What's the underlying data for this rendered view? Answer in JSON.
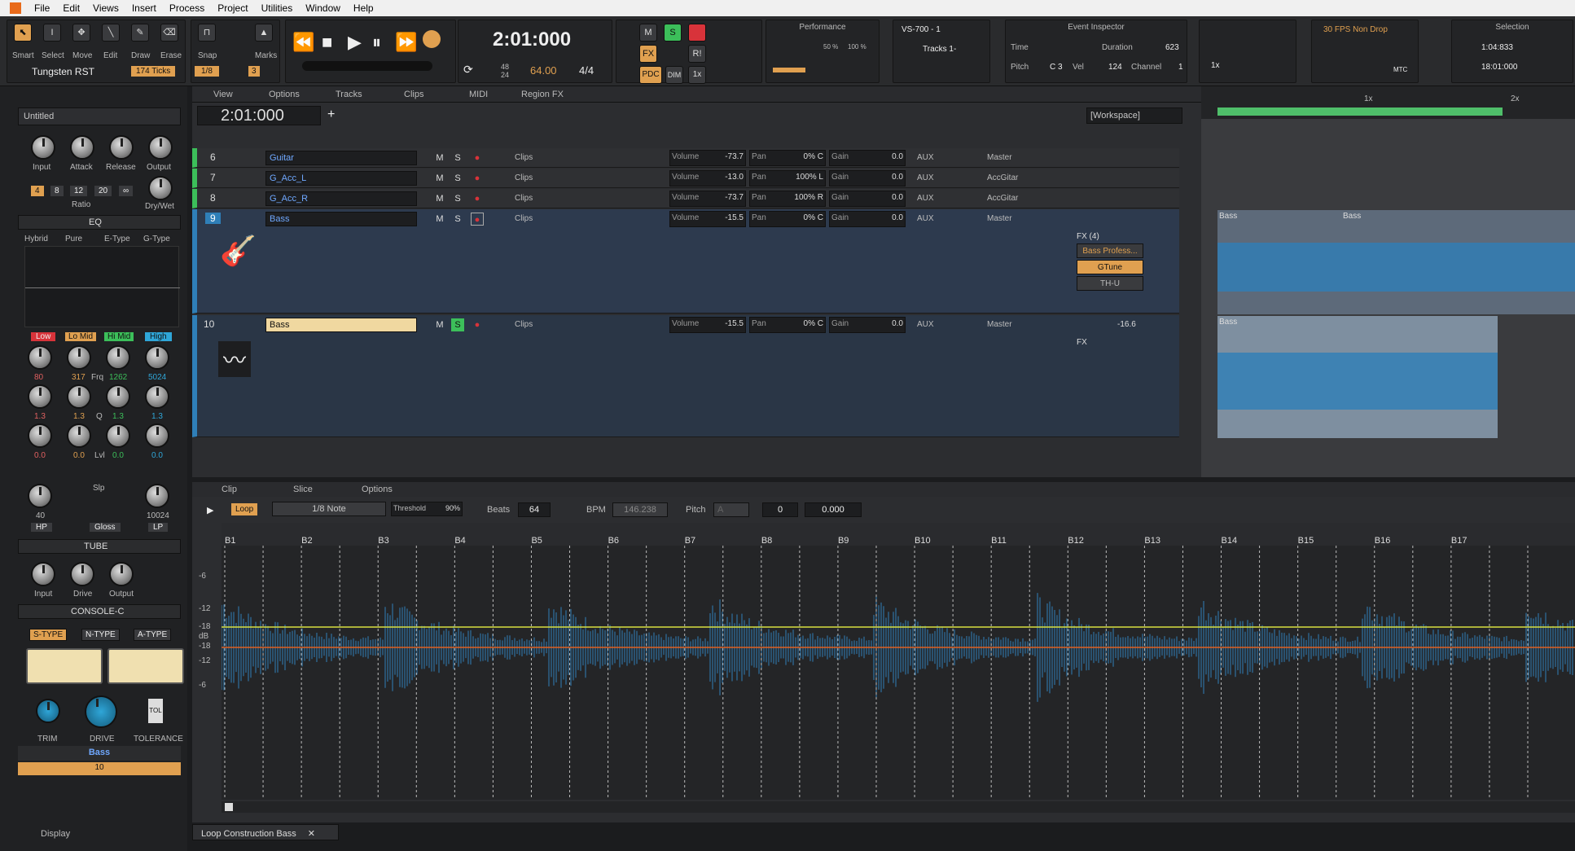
{
  "menu": [
    "File",
    "Edit",
    "Views",
    "Insert",
    "Process",
    "Project",
    "Utilities",
    "Window",
    "Help"
  ],
  "tools": {
    "labels": [
      "Smart",
      "Select",
      "Move",
      "Edit",
      "Draw",
      "Erase"
    ],
    "preset": "Tungsten RST",
    "ticks": "174 Ticks",
    "snap": "Snap",
    "snap_value": "1/8",
    "snap_num": "3",
    "marks": "Marks"
  },
  "transport": {
    "time": "2:01:000",
    "tempo": "64.00",
    "tempo_top": "48",
    "tempo_bot": "24",
    "meter": "4/4"
  },
  "mix": {
    "m": "M",
    "s": "S",
    "fx": "FX",
    "pdc": "PDC",
    "dim": "DIM",
    "speed": "1x",
    "ri": "R!"
  },
  "performance": {
    "title": "Performance",
    "p1": "50 %",
    "p2": "100 %"
  },
  "device": {
    "name": "VS-700 - 1",
    "tracks": "Tracks 1-"
  },
  "event_inspector": {
    "title": "Event Inspector",
    "time": "Time",
    "duration": "Duration",
    "duration_val": "623",
    "pitch": "Pitch",
    "pitch_val": "C 3",
    "vel": "Vel",
    "vel_val": "124",
    "channel": "Channel",
    "channel_val": "1"
  },
  "sync": {
    "fps": "30 FPS Non Drop",
    "speed": "1x",
    "mtc": "MTC"
  },
  "selection": {
    "title": "Selection",
    "start": "1:04:833",
    "end": "18:01:000"
  },
  "inspector": {
    "preset": "Untitled",
    "comp_labels": [
      "Input",
      "Attack",
      "Release",
      "Output"
    ],
    "ratios": [
      "4",
      "8",
      "12",
      "20",
      "∞"
    ],
    "ratio": "Ratio",
    "drywet": "Dry/Wet",
    "eq_title": "EQ",
    "eq_modes": [
      "Hybrid",
      "Pure",
      "E-Type",
      "G-Type"
    ],
    "eq_bands": [
      "Low",
      "Lo Mid",
      "Hi Mid",
      "High"
    ],
    "eq_freqs": [
      "80",
      "317",
      "1262",
      "5024"
    ],
    "frq": "Frq",
    "eq_q": [
      "1.3",
      "1.3",
      "1.3",
      "1.3"
    ],
    "q": "Q",
    "eq_gain": [
      "0.0",
      "0.0",
      "0.0",
      "0.0"
    ],
    "lvl": "Lvl",
    "hp": "HP",
    "hp_val": "40",
    "gloss": "Gloss",
    "lp": "LP",
    "lp_val": "10024",
    "slp": "Slp",
    "tube_title": "TUBE",
    "tube_labels": [
      "Input",
      "Drive",
      "Output"
    ],
    "console_title": "CONSOLE-C",
    "console_types": [
      "S-TYPE",
      "N-TYPE",
      "A-TYPE"
    ],
    "console_labels": [
      "TRIM",
      "DRIVE",
      "TOLERANCE"
    ],
    "tol": "TOL",
    "track_name": "Bass",
    "track_num": "10",
    "display": "Display"
  },
  "track_menu": [
    "View",
    "Options",
    "Tracks",
    "Clips",
    "MIDI",
    "Region FX"
  ],
  "now_time": "2:01:000",
  "workspace": "[Workspace]",
  "tracks": [
    {
      "num": "6",
      "name": "Guitar",
      "clips": "Clips",
      "volume": "-73.7",
      "pan": "0% C",
      "gain": "0.0",
      "aux": "AUX",
      "out": "Master"
    },
    {
      "num": "7",
      "name": "G_Acc_L",
      "clips": "Clips",
      "volume": "-13.0",
      "pan": "100% L",
      "gain": "0.0",
      "aux": "AUX",
      "out": "AccGitar"
    },
    {
      "num": "8",
      "name": "G_Acc_R",
      "clips": "Clips",
      "volume": "-73.7",
      "pan": "100% R",
      "gain": "0.0",
      "aux": "AUX",
      "out": "AccGitar"
    },
    {
      "num": "9",
      "name": "Bass",
      "clips": "Clips",
      "volume": "-15.5",
      "pan": "0% C",
      "gain": "0.0",
      "aux": "AUX",
      "out": "Master"
    },
    {
      "num": "10",
      "name": "Bass",
      "clips": "Clips",
      "volume": "-15.5",
      "pan": "0% C",
      "gain": "0.0",
      "aux": "AUX",
      "out": "Master",
      "meter": "-16.6"
    }
  ],
  "fader_labels": {
    "volume": "Volume",
    "pan": "Pan",
    "gain": "Gain"
  },
  "fx9": {
    "title": "FX (4)",
    "items": [
      "Bass Profess...",
      "GTune",
      "TH-U"
    ]
  },
  "fx10": {
    "title": "FX"
  },
  "clip_labels": {
    "c1": "Bass",
    "c2": "Bass",
    "c3": "Bass",
    "r1": "1x",
    "r2": "2x"
  },
  "loop": {
    "menu": [
      "Clip",
      "Slice",
      "Options"
    ],
    "loop": "Loop",
    "note": "1/8 Note",
    "threshold": "Threshold",
    "thr_val": "90%",
    "beats": "Beats",
    "beats_val": "64",
    "bpm": "BPM",
    "bpm_val": "146.238",
    "pitch": "Pitch",
    "pitch_a": "A",
    "pitch_val": "0",
    "pitch_fine": "0.000",
    "bars": [
      "B1",
      "B2",
      "B3",
      "B4",
      "B5",
      "B6",
      "B7",
      "B8",
      "B9",
      "B10",
      "B11",
      "B12",
      "B13",
      "B14",
      "B15",
      "B16",
      "B17"
    ],
    "db": [
      "-6",
      "-12",
      "-18",
      "dB",
      "-18",
      "-12",
      "-6"
    ]
  },
  "bottom_tab": "Loop Construction Bass",
  "colors": {
    "accent": "#e0a050",
    "wave": "#2f7fb8",
    "yellow_line": "#d8e040",
    "orange_line": "#e06020"
  }
}
